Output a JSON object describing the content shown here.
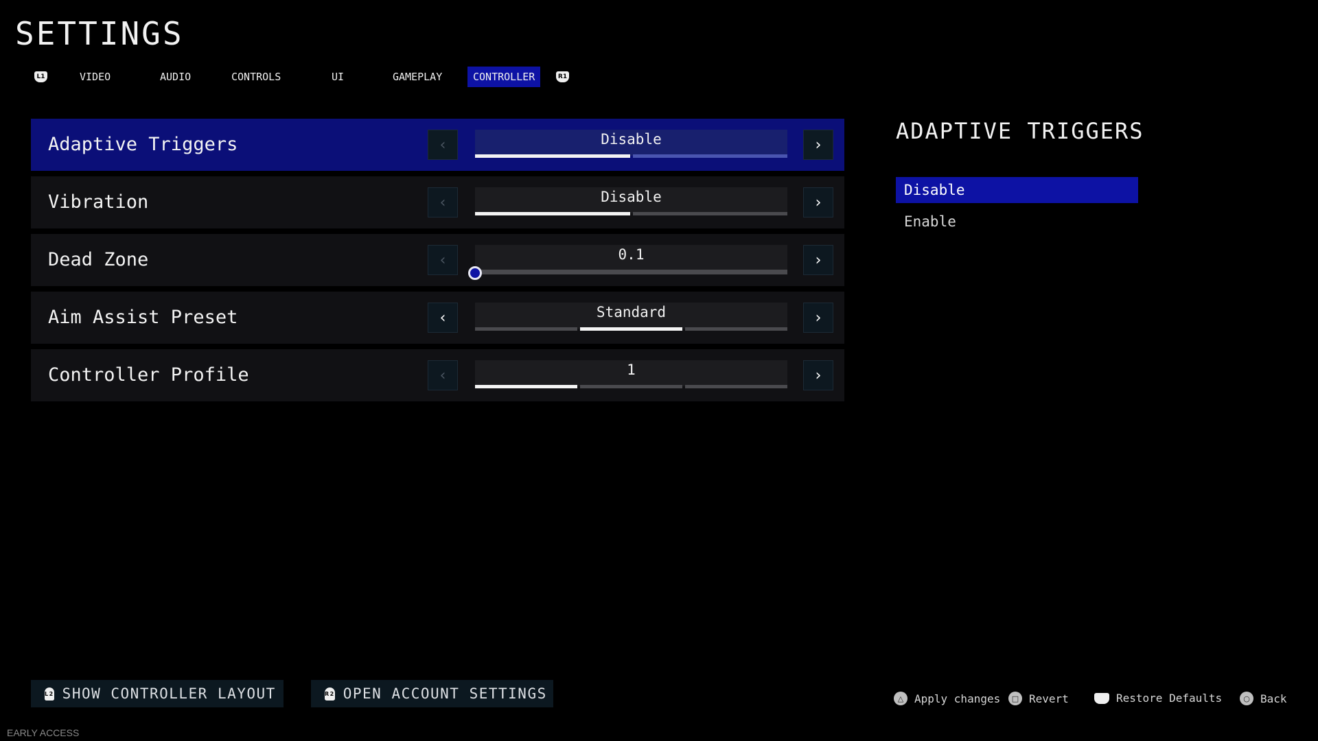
{
  "header": {
    "title": "SETTINGS"
  },
  "tabs": {
    "prev_button_glyph": "L1",
    "next_button_glyph": "R1",
    "items": [
      {
        "label": "VIDEO",
        "active": false
      },
      {
        "label": "AUDIO",
        "active": false
      },
      {
        "label": "CONTROLS",
        "active": false
      },
      {
        "label": "UI",
        "active": false
      },
      {
        "label": "GAMEPLAY",
        "active": false
      },
      {
        "label": "CONTROLLER",
        "active": true
      }
    ]
  },
  "settings": [
    {
      "label": "Adaptive Triggers",
      "type": "options",
      "value": "Disable",
      "option_count": 2,
      "selected_index": 0,
      "left_enabled": false,
      "right_enabled": true,
      "focused": true
    },
    {
      "label": "Vibration",
      "type": "options",
      "value": "Disable",
      "option_count": 2,
      "selected_index": 0,
      "left_enabled": false,
      "right_enabled": true,
      "focused": false
    },
    {
      "label": "Dead Zone",
      "type": "slider",
      "value": "0.1",
      "slider_fraction": 0.0,
      "left_enabled": false,
      "right_enabled": true,
      "focused": false
    },
    {
      "label": "Aim Assist Preset",
      "type": "options",
      "value": "Standard",
      "option_count": 3,
      "selected_index": 1,
      "left_enabled": true,
      "right_enabled": true,
      "focused": false
    },
    {
      "label": "Controller Profile",
      "type": "options",
      "value": "1",
      "option_count": 3,
      "selected_index": 0,
      "left_enabled": false,
      "right_enabled": true,
      "focused": false
    }
  ],
  "side_panel": {
    "title": "ADAPTIVE TRIGGERS",
    "options": [
      {
        "label": "Disable",
        "selected": true
      },
      {
        "label": "Enable",
        "selected": false
      }
    ]
  },
  "bottom_buttons": [
    {
      "glyph": "L2",
      "label": "SHOW CONTROLLER LAYOUT"
    },
    {
      "glyph": "R2",
      "label": "OPEN ACCOUNT SETTINGS"
    }
  ],
  "hints": [
    {
      "icon": "triangle-icon",
      "glyph": "△",
      "label": "Apply changes"
    },
    {
      "icon": "square-icon",
      "glyph": "□",
      "label": "Revert"
    },
    {
      "icon": "touchpad-icon",
      "glyph": "",
      "label": "Restore Defaults"
    },
    {
      "icon": "circle-icon",
      "glyph": "○",
      "label": "Back"
    }
  ],
  "footer": {
    "build_label": "EARLY ACCESS"
  },
  "colors": {
    "accent": "#0d12a4",
    "focused_row": "#0b0f78",
    "row_bg": "#111114"
  }
}
